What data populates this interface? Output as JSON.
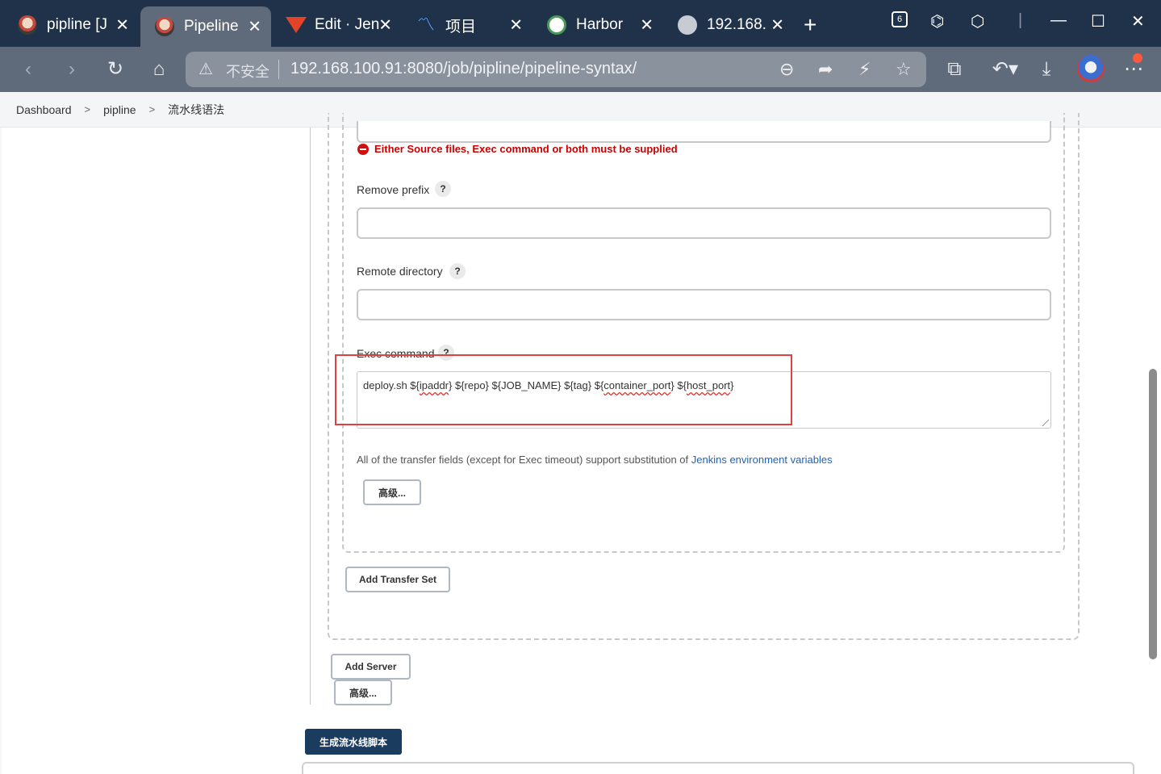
{
  "tabs": [
    {
      "title": "pipline [J",
      "favicon": "jenkins-icon"
    },
    {
      "title": "Pipeline",
      "favicon": "jenkins-icon",
      "active": true
    },
    {
      "title": "Edit · Jen",
      "favicon": "gitlab-icon"
    },
    {
      "title": "项目",
      "favicon": "tekton-icon"
    },
    {
      "title": "Harbor",
      "favicon": "harbor-icon"
    },
    {
      "title": "192.168.",
      "favicon": "globe-icon"
    }
  ],
  "tab_close_glyph": "✕",
  "new_tab_glyph": "+",
  "window_controls": {
    "minimize": "—",
    "maximize": "☐",
    "close": "✕"
  },
  "address_bar": {
    "security_label": "不安全",
    "url": "192.168.100.91:8080/job/pipline/pipeline-syntax/"
  },
  "breadcrumb": {
    "items": [
      "Dashboard",
      "pipline",
      "流水线语法"
    ],
    "separator": ">"
  },
  "form": {
    "error_message": "Either Source files, Exec command or both must be supplied",
    "remove_prefix": {
      "label": "Remove prefix",
      "value": ""
    },
    "remote_directory": {
      "label": "Remote directory",
      "value": ""
    },
    "exec_command": {
      "label": "Exec command",
      "value_parts": [
        "deploy.sh ${",
        "ipaddr",
        "} ${repo} ${JOB_NAME} ${tag} ${",
        "container_port",
        "} ${",
        "host_port",
        "}"
      ]
    },
    "help_glyph": "?",
    "transfer_note": "All of the transfer fields (except for Exec timeout) support substitution of ",
    "transfer_note_link": "Jenkins environment variables",
    "advanced_button_inner": "高级...",
    "add_transfer_set_button": "Add Transfer Set",
    "add_server_button": "Add Server",
    "advanced_button_outer": "高级...",
    "generate_button": "生成流水线脚本"
  },
  "colors": {
    "tabstrip_bg": "#20324a",
    "toolbar_bg": "#5f6b7a",
    "error_red": "#cc0000",
    "highlight_red": "#e04040",
    "link_blue": "#1f63b6",
    "primary_button": "#1a3c5e"
  }
}
